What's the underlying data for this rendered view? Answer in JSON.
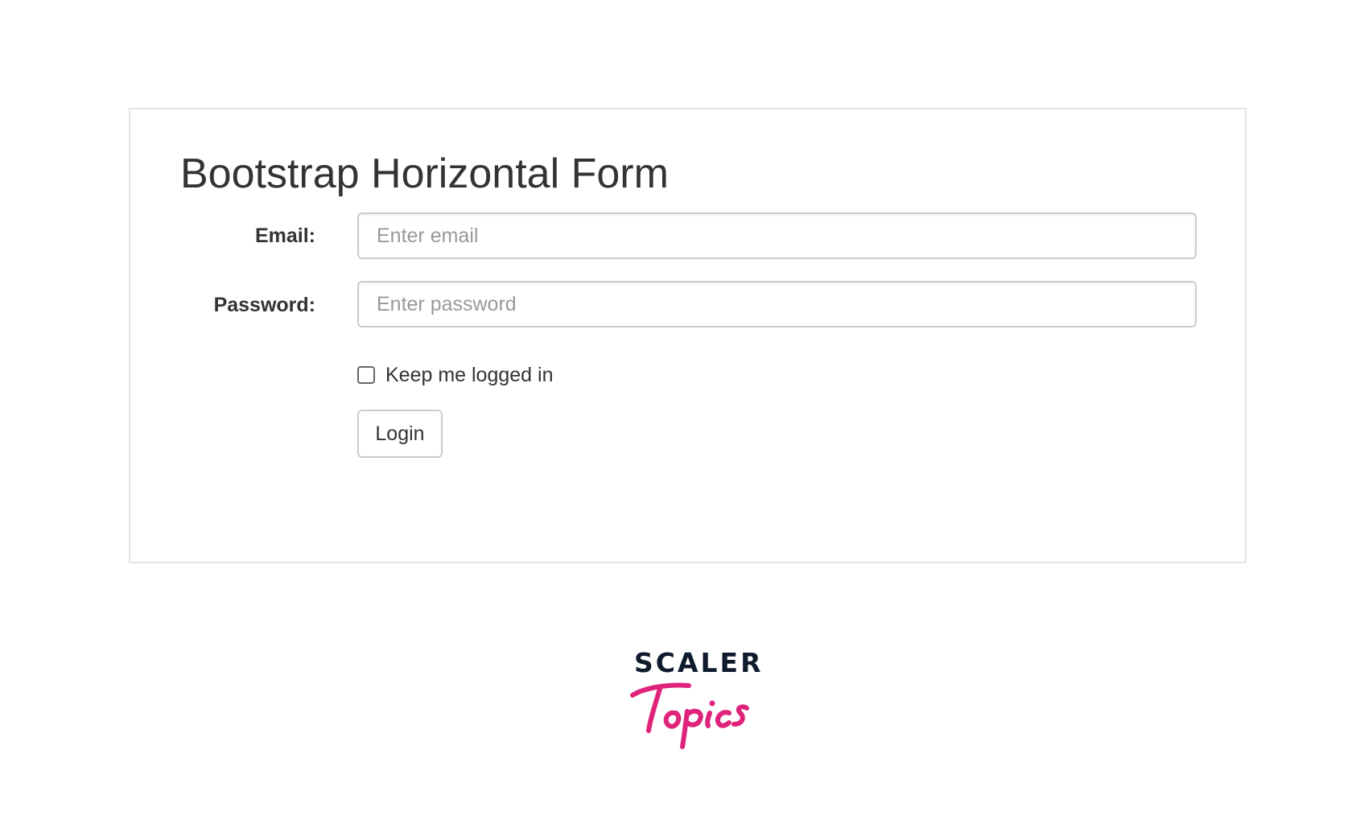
{
  "form": {
    "title": "Bootstrap Horizontal Form",
    "email_label": "Email:",
    "email_placeholder": "Enter email",
    "email_value": "",
    "password_label": "Password:",
    "password_placeholder": "Enter password",
    "password_value": "",
    "remember_label": "Keep me logged in",
    "remember_checked": false,
    "login_label": "Login"
  },
  "logo": {
    "brand": "SCALER",
    "product": "Topics",
    "brand_color": "#0f1b2d",
    "product_color": "#e0237a"
  }
}
